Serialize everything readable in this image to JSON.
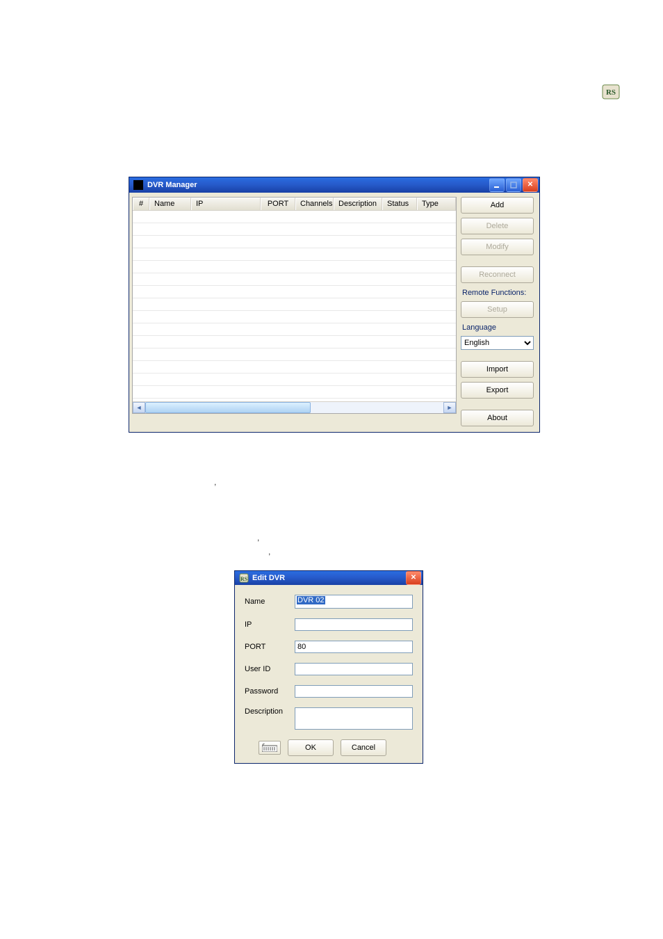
{
  "logo": {
    "name": "rasilient-logo"
  },
  "dvrManager": {
    "title": "DVR Manager",
    "columns": {
      "num": "#",
      "name": "Name",
      "ip": "IP",
      "port": "PORT",
      "channels": "Channels",
      "description": "Description",
      "status": "Status",
      "type": "Type"
    },
    "buttons": {
      "add": "Add",
      "delete": "Delete",
      "modify": "Modify",
      "reconnect": "Reconnect",
      "setup": "Setup",
      "import": "Import",
      "export": "Export",
      "about": "About"
    },
    "labels": {
      "remoteFunctions": "Remote Functions:",
      "language": "Language"
    },
    "language": {
      "selected": "English"
    }
  },
  "editDvr": {
    "title": "Edit DVR",
    "labels": {
      "name": "Name",
      "ip": "IP",
      "port": "PORT",
      "userid": "User ID",
      "password": "Password",
      "description": "Description"
    },
    "values": {
      "name": "DVR 02",
      "ip": "",
      "port": "80",
      "userid": "",
      "password": "",
      "description": ""
    },
    "buttons": {
      "ok": "OK",
      "cancel": "Cancel"
    }
  },
  "punct": {
    "comma": ","
  }
}
